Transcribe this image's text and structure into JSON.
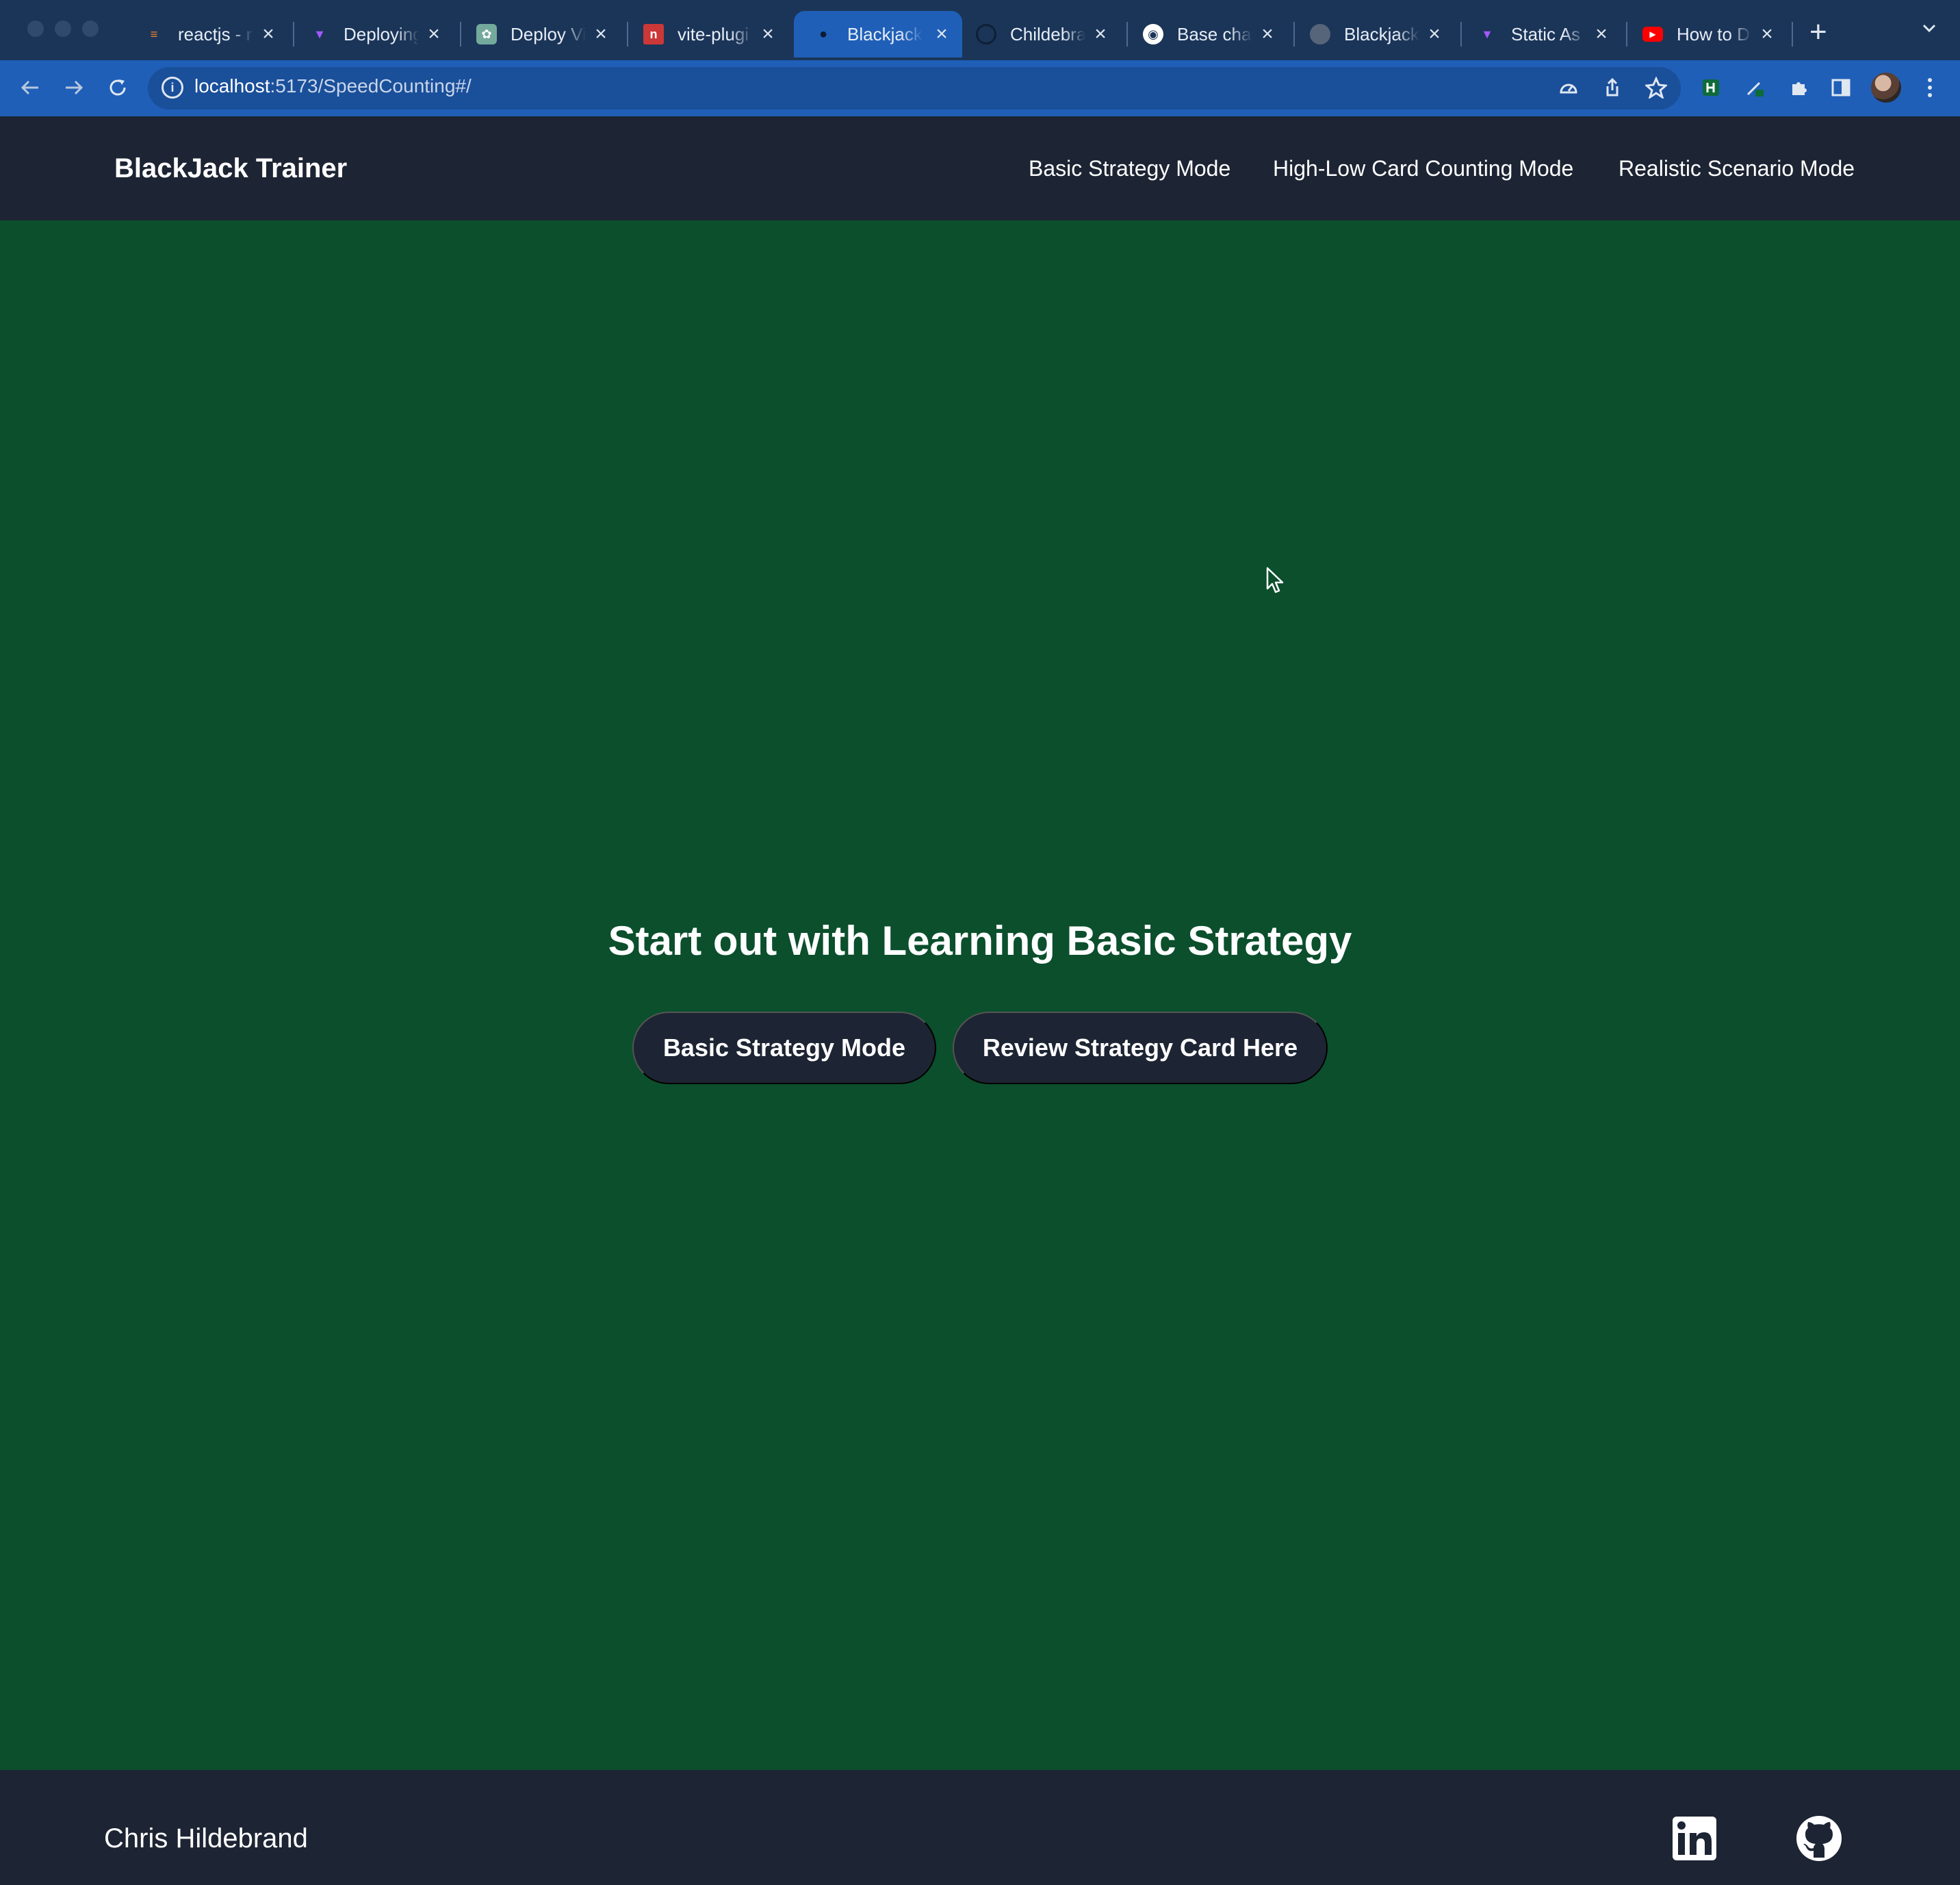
{
  "browser": {
    "tabs": [
      {
        "title": "reactjs - r",
        "icon": "stackoverflow-icon",
        "color": "#f48024"
      },
      {
        "title": "Deploying",
        "icon": "vite-icon",
        "color": "#a259ff"
      },
      {
        "title": "Deploy Vi",
        "icon": "chatgpt-icon",
        "color": "#74aa9c"
      },
      {
        "title": "vite-plugi",
        "icon": "npm-icon",
        "color": "#cb3837"
      },
      {
        "title": "Blackjack",
        "icon": "blackjack-icon",
        "color": "#1f5fb8",
        "active": true
      },
      {
        "title": "Childebra",
        "icon": "github-icon",
        "color": "#1b3558"
      },
      {
        "title": "Base char",
        "icon": "github-icon",
        "color": "#1b3558"
      },
      {
        "title": "Blackjack",
        "icon": "globe-icon",
        "color": "#56657a"
      },
      {
        "title": "Static As",
        "icon": "vite-icon",
        "color": "#a259ff"
      },
      {
        "title": "How to D",
        "icon": "youtube-icon",
        "color": "#ff0000"
      }
    ],
    "url": {
      "host": "localhost",
      "path": ":5173/SpeedCounting#/"
    }
  },
  "navbar": {
    "brand": "BlackJack Trainer",
    "links": [
      "Basic Strategy Mode",
      "High-Low Card Counting Mode",
      "Realistic Scenario Mode"
    ]
  },
  "hero": {
    "title": "Start out with Learning Basic Strategy",
    "buttons": [
      "Basic Strategy Mode",
      "Review Strategy Card Here"
    ]
  },
  "footer": {
    "author": "Chris Hildebrand",
    "icons": [
      "linkedin-icon",
      "github-icon"
    ]
  },
  "colors": {
    "page_background": "#0b4f2d",
    "navbar_background": "#1d2433",
    "button_background": "#1d2433",
    "browser_frame": "#1b3558",
    "active_tab": "#1f5fb8"
  }
}
